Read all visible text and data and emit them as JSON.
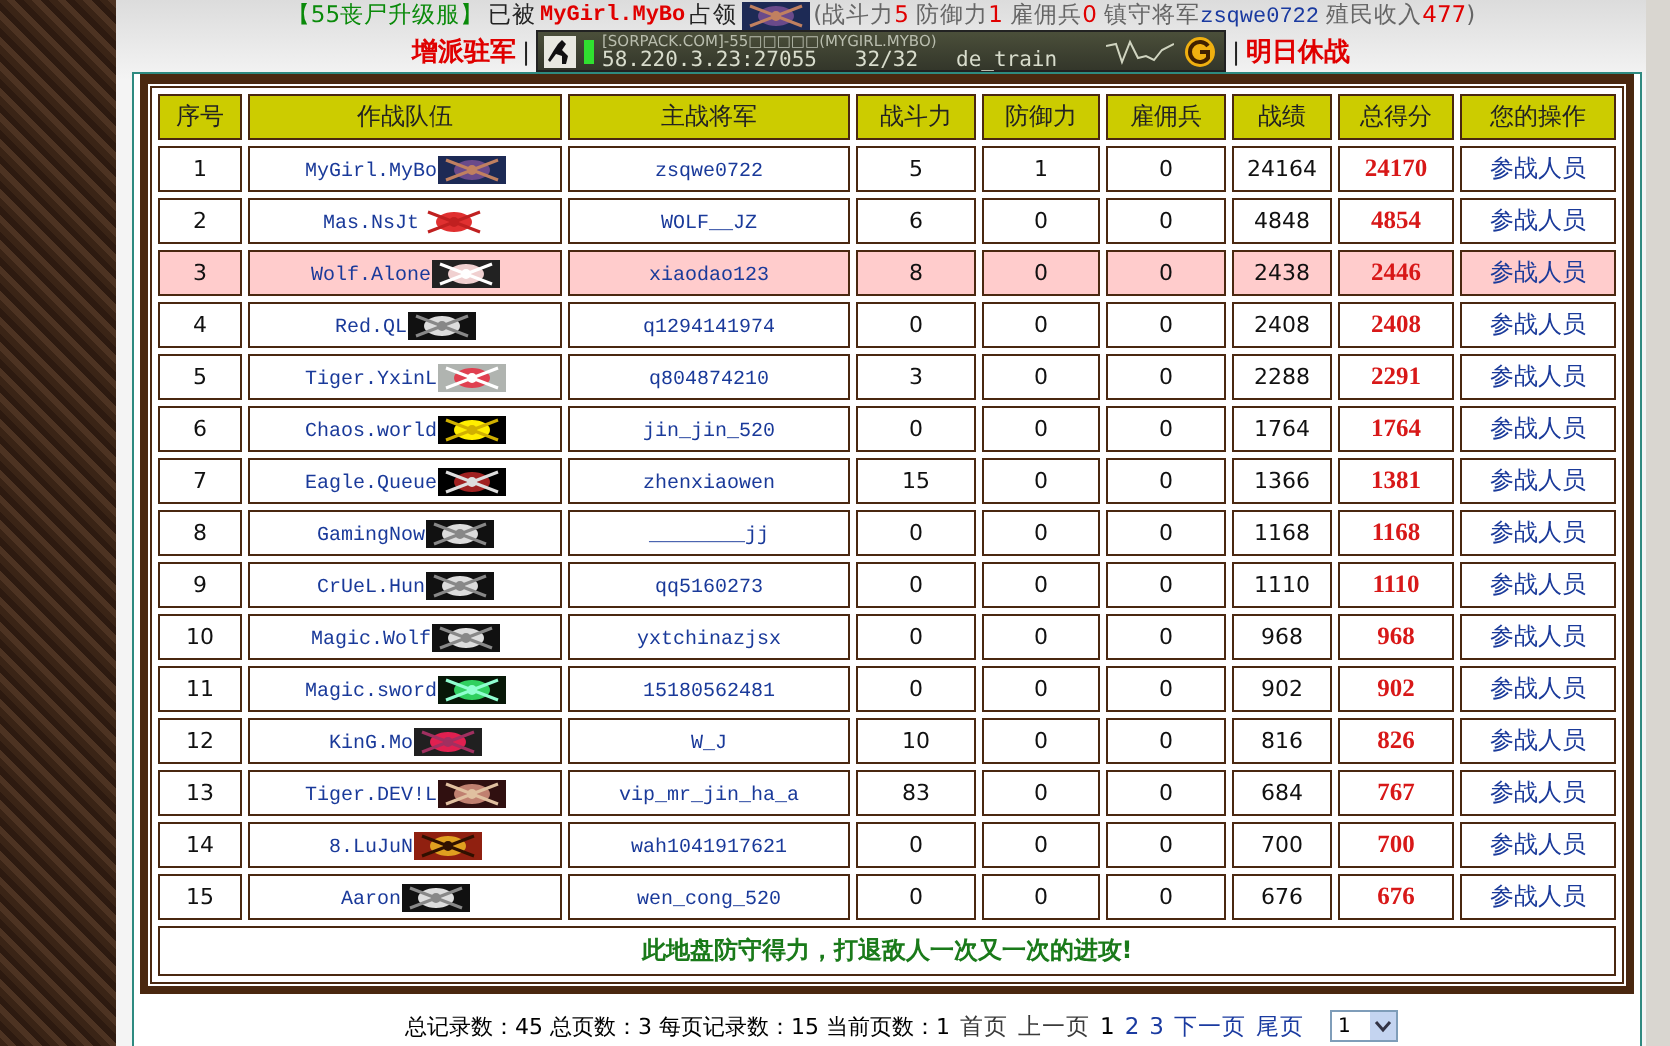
{
  "header": {
    "server_name": "【55丧尸升级服】",
    "occupied_prefix": "已被",
    "occupier": "MyGirl.MyBo",
    "occupied_suffix": "占领",
    "stats_open": "(",
    "stats": [
      {
        "label": "战斗力",
        "value": "5"
      },
      {
        "label": "防御力",
        "value": "1"
      },
      {
        "label": "雇佣兵",
        "value": "0"
      }
    ],
    "general_label": "镇守将军",
    "general": "zsqwe0722",
    "income_label": "殖民收入",
    "income": "477",
    "stats_close": ")"
  },
  "actions": {
    "left": "增派驻军",
    "separator_left": "|",
    "separator_right": "|",
    "right": "明日休战"
  },
  "server_banner": {
    "title": "[SORPACK.COM]-55□□□□□(MYGIRL.MYBO)",
    "address": "58.220.3.23:27055",
    "players": "32/32",
    "map": "de_train"
  },
  "table": {
    "columns": [
      "序号",
      "作战队伍",
      "主战将军",
      "战斗力",
      "防御力",
      "雇佣兵",
      "战绩",
      "总得分",
      "您的操作"
    ],
    "rows": [
      {
        "no": "1",
        "team": "MyGirl.MyBo",
        "general": "zsqwe0722",
        "attack": "5",
        "defense": "1",
        "mercenaries": "0",
        "record": "24164",
        "score": "24170",
        "action": "参战人员",
        "selected": false
      },
      {
        "no": "2",
        "team": "Mas.NsJt",
        "general": "WOLF__JZ",
        "attack": "6",
        "defense": "0",
        "mercenaries": "0",
        "record": "4848",
        "score": "4854",
        "action": "参战人员",
        "selected": false
      },
      {
        "no": "3",
        "team": "Wolf.Alone",
        "general": "xiaodao123",
        "attack": "8",
        "defense": "0",
        "mercenaries": "0",
        "record": "2438",
        "score": "2446",
        "action": "参战人员",
        "selected": true
      },
      {
        "no": "4",
        "team": "Red.QL",
        "general": "q1294141974",
        "attack": "0",
        "defense": "0",
        "mercenaries": "0",
        "record": "2408",
        "score": "2408",
        "action": "参战人员",
        "selected": false
      },
      {
        "no": "5",
        "team": "Tiger.YxinL",
        "general": "q804874210",
        "attack": "3",
        "defense": "0",
        "mercenaries": "0",
        "record": "2288",
        "score": "2291",
        "action": "参战人员",
        "selected": false
      },
      {
        "no": "6",
        "team": "Chaos.world",
        "general": "jin_jin_520",
        "attack": "0",
        "defense": "0",
        "mercenaries": "0",
        "record": "1764",
        "score": "1764",
        "action": "参战人员",
        "selected": false
      },
      {
        "no": "7",
        "team": "Eagle.Queue",
        "general": "zhenxiaowen",
        "attack": "15",
        "defense": "0",
        "mercenaries": "0",
        "record": "1366",
        "score": "1381",
        "action": "参战人员",
        "selected": false
      },
      {
        "no": "8",
        "team": "GamingNow",
        "general": "________jj",
        "attack": "0",
        "defense": "0",
        "mercenaries": "0",
        "record": "1168",
        "score": "1168",
        "action": "参战人员",
        "selected": false
      },
      {
        "no": "9",
        "team": "CrUeL.Hun",
        "general": "qq5160273",
        "attack": "0",
        "defense": "0",
        "mercenaries": "0",
        "record": "1110",
        "score": "1110",
        "action": "参战人员",
        "selected": false
      },
      {
        "no": "10",
        "team": "Magic.Wolf",
        "general": "yxtchinazjsx",
        "attack": "0",
        "defense": "0",
        "mercenaries": "0",
        "record": "968",
        "score": "968",
        "action": "参战人员",
        "selected": false
      },
      {
        "no": "11",
        "team": "Magic.sword",
        "general": "15180562481",
        "attack": "0",
        "defense": "0",
        "mercenaries": "0",
        "record": "902",
        "score": "902",
        "action": "参战人员",
        "selected": false
      },
      {
        "no": "12",
        "team": "KinG.Mo",
        "general": "W_J",
        "attack": "10",
        "defense": "0",
        "mercenaries": "0",
        "record": "816",
        "score": "826",
        "action": "参战人员",
        "selected": false
      },
      {
        "no": "13",
        "team": "Tiger.DEV!L",
        "general": "vip_mr_jin_ha_a",
        "attack": "83",
        "defense": "0",
        "mercenaries": "0",
        "record": "684",
        "score": "767",
        "action": "参战人员",
        "selected": false
      },
      {
        "no": "14",
        "team": "8.LuJuN",
        "general": "wah1041917621",
        "attack": "0",
        "defense": "0",
        "mercenaries": "0",
        "record": "700",
        "score": "700",
        "action": "参战人员",
        "selected": false
      },
      {
        "no": "15",
        "team": "Aaron",
        "general": "wen_cong_520",
        "attack": "0",
        "defense": "0",
        "mercenaries": "0",
        "record": "676",
        "score": "676",
        "action": "参战人员",
        "selected": false
      }
    ],
    "footer": "此地盘防守得力，打退敌人一次又一次的进攻!"
  },
  "pagination": {
    "summary": "总记录数：45 总页数：3 每页记录数：15 当前页数：1",
    "links": [
      {
        "label": "首页",
        "disabled": true,
        "selected": false
      },
      {
        "label": "上一页",
        "disabled": true,
        "selected": false
      },
      {
        "label": "1",
        "disabled": false,
        "selected": true
      },
      {
        "label": "2",
        "disabled": false,
        "selected": false
      },
      {
        "label": "3",
        "disabled": false,
        "selected": false
      },
      {
        "label": "下一页",
        "disabled": false,
        "selected": false
      },
      {
        "label": "尾页",
        "disabled": false,
        "selected": false
      }
    ],
    "page_select": "1"
  }
}
